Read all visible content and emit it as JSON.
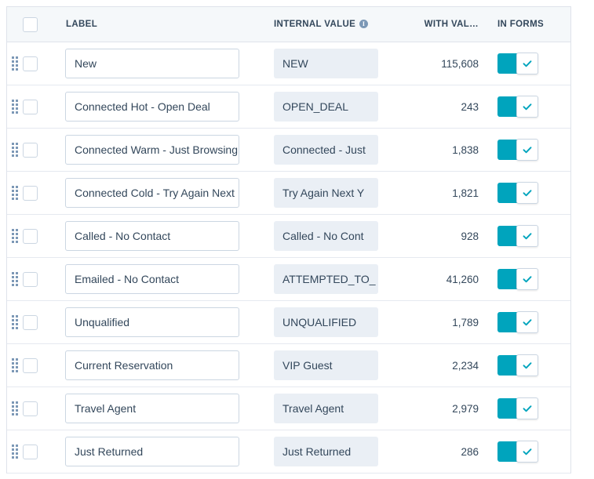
{
  "table": {
    "columns": [
      {
        "key": "drag",
        "label": ""
      },
      {
        "key": "check",
        "label": ""
      },
      {
        "key": "label",
        "label": "LABEL"
      },
      {
        "key": "value",
        "label": "INTERNAL VALUE",
        "has_info_icon": true,
        "info_glyph": "i"
      },
      {
        "key": "count",
        "label": "WITH VAL…"
      },
      {
        "key": "forms",
        "label": "IN FORMS"
      }
    ],
    "select_all_checkbox": {
      "checked": false
    },
    "rows": [
      {
        "label": "New",
        "internal_value": "NEW",
        "with_value": "115,608",
        "in_forms": true
      },
      {
        "label": "Connected Hot - Open Deal",
        "internal_value": "OPEN_DEAL",
        "with_value": "243",
        "in_forms": true
      },
      {
        "label": "Connected Warm - Just Browsing",
        "internal_value": "Connected - Just",
        "with_value": "1,838",
        "in_forms": true
      },
      {
        "label": "Connected Cold - Try Again Next",
        "internal_value": "Try Again Next Y",
        "with_value": "1,821",
        "in_forms": true
      },
      {
        "label": "Called - No Contact",
        "internal_value": "Called - No Cont",
        "with_value": "928",
        "in_forms": true
      },
      {
        "label": "Emailed - No Contact",
        "internal_value": "ATTEMPTED_TO_",
        "with_value": "41,260",
        "in_forms": true
      },
      {
        "label": "Unqualified",
        "internal_value": "UNQUALIFIED",
        "with_value": "1,789",
        "in_forms": true
      },
      {
        "label": "Current Reservation",
        "internal_value": "VIP Guest",
        "with_value": "2,234",
        "in_forms": true
      },
      {
        "label": "Travel Agent",
        "internal_value": "Travel Agent",
        "with_value": "2,979",
        "in_forms": true
      },
      {
        "label": "Just Returned",
        "internal_value": "Just Returned",
        "with_value": "286",
        "in_forms": true
      }
    ]
  },
  "colors": {
    "toggle_on": "#00a4bd",
    "header_bg": "#f5f8fa",
    "border": "#dfe3eb",
    "text": "#33475b",
    "readonly_field_bg": "#eaeff5",
    "handle_dot": "#7c98b6"
  }
}
